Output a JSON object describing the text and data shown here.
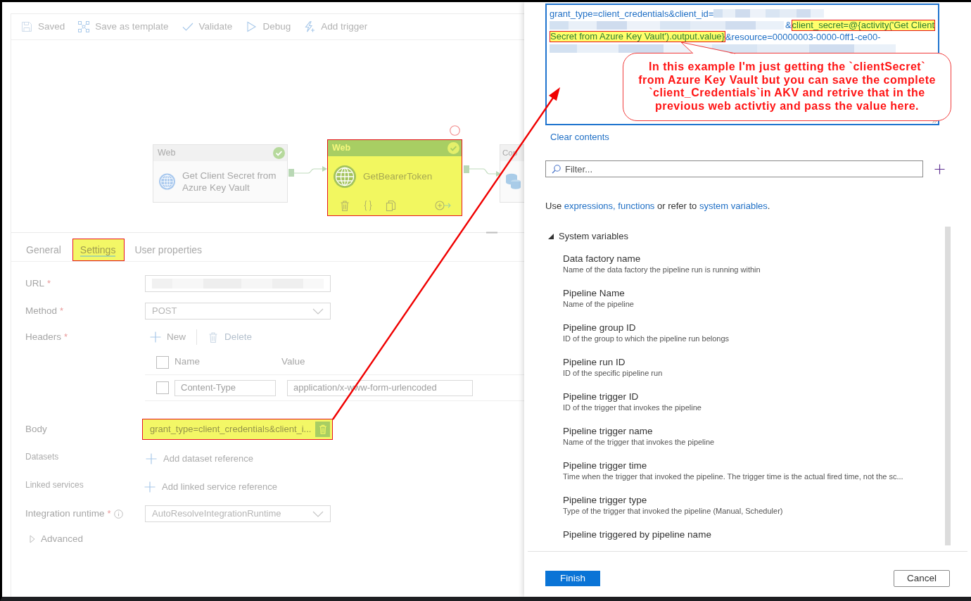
{
  "toolbar": [
    {
      "kind": "save",
      "label": "Saved"
    },
    {
      "kind": "template",
      "label": "Save as template"
    },
    {
      "kind": "validate",
      "label": "Validate"
    },
    {
      "kind": "debug",
      "label": "Debug"
    },
    {
      "kind": "trigger",
      "label": "Add trigger"
    }
  ],
  "canvas": {
    "activities": [
      {
        "kind": "web",
        "type_label": "Web",
        "name": "Get Client Secret from Azure Key Vault",
        "succeeded": true,
        "selected": false,
        "highlighted": false
      },
      {
        "kind": "web",
        "type_label": "Web",
        "name": "GetBearerToken",
        "succeeded": true,
        "selected": true,
        "highlighted": true
      },
      {
        "kind": "copy",
        "type_label": "Cop",
        "succeeded": false,
        "selected": false,
        "highlighted": false
      }
    ]
  },
  "tabs": [
    {
      "label": "General",
      "selected": false,
      "highlighted": false
    },
    {
      "label": "Settings",
      "selected": true,
      "highlighted": true
    },
    {
      "label": "User properties",
      "selected": false,
      "highlighted": false
    }
  ],
  "settings": {
    "url": {
      "label": "URL",
      "required_mark": "*",
      "redacted": true
    },
    "method": {
      "label": "Method",
      "required_mark": "*",
      "value": "POST"
    },
    "headers": {
      "label": "Headers",
      "required_mark": "*",
      "new_label": "New",
      "delete_label": "Delete",
      "delete_disabled": true,
      "columns": [
        "Name",
        "Value"
      ],
      "select_all_checked": false,
      "rows": [
        {
          "checked": false,
          "name": "Content-Type",
          "value": "application/x-www-form-urlencoded"
        }
      ]
    },
    "body": {
      "label": "Body",
      "value": "grant_type=client_credentials&client_i...",
      "highlighted": true
    },
    "datasets": {
      "label": "Datasets",
      "action": "Add dataset reference"
    },
    "linked_services": {
      "label": "Linked services",
      "action": "Add linked service reference"
    },
    "integration_runtime": {
      "label": "Integration runtime",
      "required_mark": "*",
      "value": "AutoResolveIntegrationRuntime"
    },
    "advanced": {
      "label": "Advanced",
      "expanded": false
    }
  },
  "expression": {
    "lines": [
      [
        {
          "kind": "text",
          "text": "grant_type=client_credentials&client_id="
        },
        {
          "kind": "redacted"
        }
      ],
      [
        {
          "kind": "redacted"
        },
        {
          "kind": "text",
          "text": "&"
        },
        {
          "kind": "highlight",
          "text": "client_secret=@{activity('Get Client"
        }
      ],
      [
        {
          "kind": "highlight",
          "text": "Secret from Azure Key Vault').output.value}"
        },
        {
          "kind": "text",
          "text": "&resource=00000003-0000-0ff1-ce00-"
        }
      ],
      [
        {
          "kind": "redacted"
        }
      ]
    ],
    "clear_label": "Clear contents"
  },
  "callout": {
    "text": "In this example I'm just getting the `clientSecret` from Azure Key Vault but you can save the complete `client_Credentials`in AKV and retrive that in the previous web activtiy and pass the value here."
  },
  "filter": {
    "placeholder": "Filter..."
  },
  "help": [
    {
      "kind": "text",
      "text": "Use "
    },
    {
      "kind": "link",
      "text": "expressions, functions"
    },
    {
      "kind": "text",
      "text": " or refer to "
    },
    {
      "kind": "link",
      "text": "system variables"
    },
    {
      "kind": "text",
      "text": "."
    }
  ],
  "system_variables": {
    "title": "System variables",
    "expanded": true,
    "items": [
      {
        "name": "Data factory name",
        "description": "Name of the data factory the pipeline run is running within"
      },
      {
        "name": "Pipeline Name",
        "description": "Name of the pipeline"
      },
      {
        "name": "Pipeline group ID",
        "description": "ID of the group to which the pipeline run belongs"
      },
      {
        "name": "Pipeline run ID",
        "description": "ID of the specific pipeline run"
      },
      {
        "name": "Pipeline trigger ID",
        "description": "ID of the trigger that invokes the pipeline"
      },
      {
        "name": "Pipeline trigger name",
        "description": "Name of the trigger that invokes the pipeline"
      },
      {
        "name": "Pipeline trigger time",
        "description": "Time when the trigger that invoked the pipeline. The trigger time is the actual fired time, not the sc..."
      },
      {
        "name": "Pipeline trigger type",
        "description": "Type of the trigger that invoked the pipeline (Manual, Scheduler)"
      },
      {
        "name": "Pipeline triggered by pipeline name"
      }
    ]
  },
  "buttons": [
    {
      "kind": "primary",
      "label": "Finish"
    },
    {
      "kind": "secondary",
      "label": "Cancel"
    }
  ]
}
